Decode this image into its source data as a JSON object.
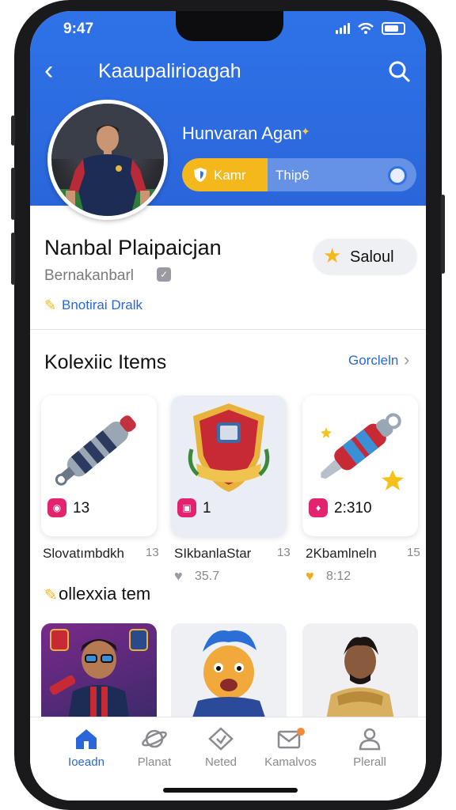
{
  "status": {
    "time": "9:47"
  },
  "nav": {
    "title": "Kaaupalirioagah"
  },
  "header": {
    "name": "Hunvaran Agan",
    "pill_left": "Kamr",
    "pill_right": "Thip6"
  },
  "profile": {
    "name": "Nanbal Plaipaicjan",
    "username": "Bernakanbarl",
    "link": "Bnotirai Dralk",
    "follow_label": "Saloul"
  },
  "collection": {
    "title": "Kolexiic Items",
    "see_all": "Gorcleln",
    "items": [
      {
        "value": "13",
        "name": "Slovatımbdkh",
        "count": "13",
        "likes": ""
      },
      {
        "value": "1",
        "name": "SIkbanlaStar",
        "count": "13",
        "likes": "35.7"
      },
      {
        "value": "2:310",
        "name": "2Kbamlneln",
        "count": "15",
        "likes": "8:12"
      }
    ]
  },
  "collection2": {
    "title": "ollexxia tem"
  },
  "tabs": [
    {
      "label": "Ioeadn",
      "icon": "home-icon"
    },
    {
      "label": "Planat",
      "icon": "planet-icon"
    },
    {
      "label": "Neted",
      "icon": "diamond-icon"
    },
    {
      "label": "Kamalvos",
      "icon": "mail-icon"
    },
    {
      "label": "Plerall",
      "icon": "profile-icon"
    }
  ],
  "colors": {
    "brand": "#2f72e8",
    "accent": "#f5b81c",
    "badge": "#e3236d"
  }
}
